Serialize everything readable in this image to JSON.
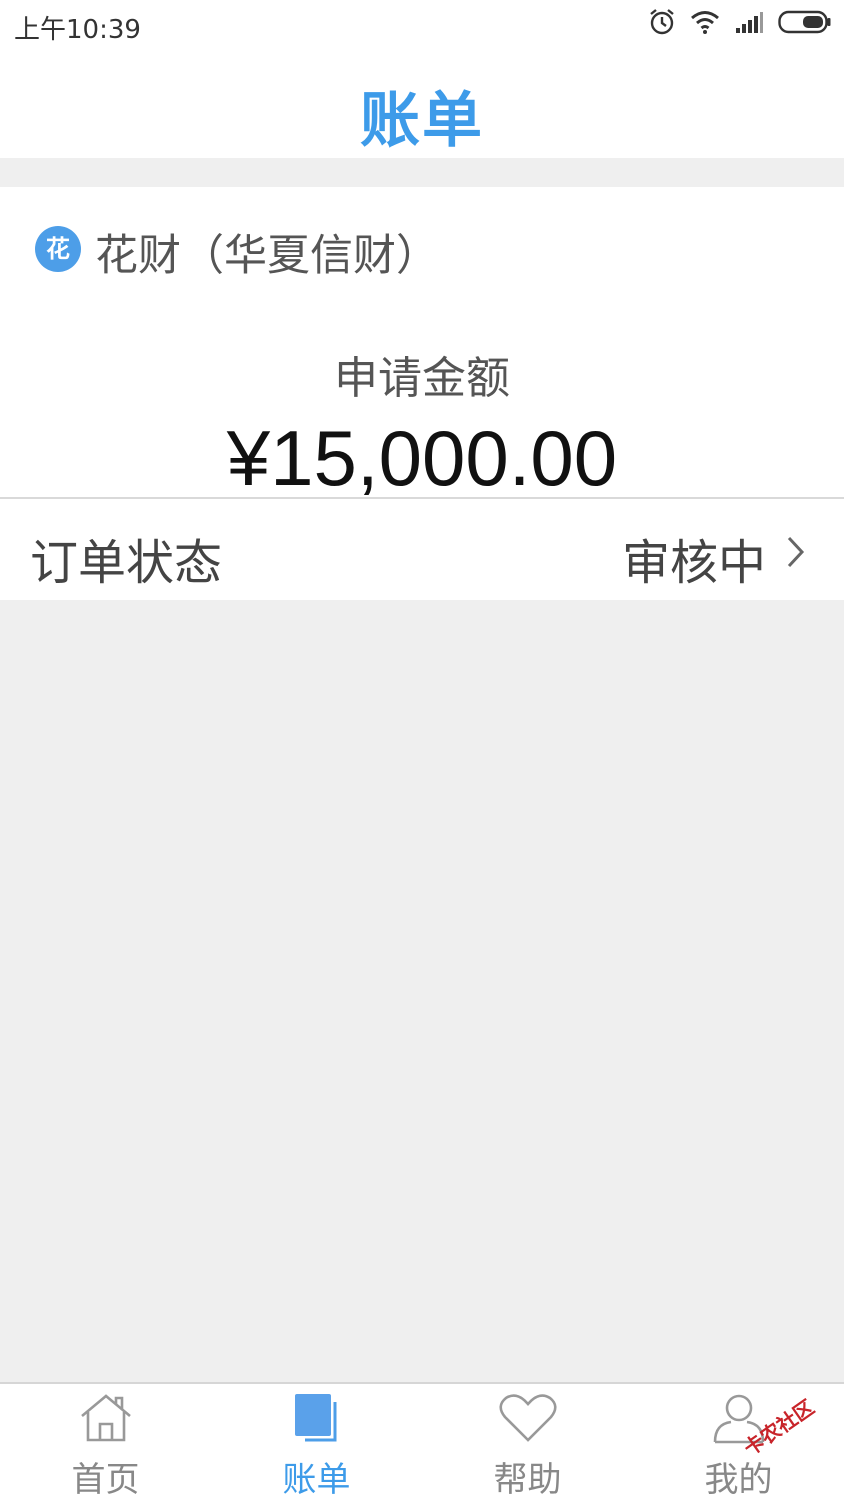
{
  "status_bar": {
    "time": "上午10:39",
    "icons": [
      "alarm-icon",
      "wifi-icon",
      "signal-icon",
      "battery-icon"
    ]
  },
  "header": {
    "title": "账单"
  },
  "order_card": {
    "badge": "花",
    "product_name": "花财（华夏信财）",
    "amount_label": "申请金额",
    "amount_value": "¥15,000.00"
  },
  "order_status": {
    "label": "订单状态",
    "value": "审核中"
  },
  "tabbar": {
    "items": [
      {
        "label": "首页",
        "icon": "home-icon",
        "active": false
      },
      {
        "label": "账单",
        "icon": "bill-icon",
        "active": true
      },
      {
        "label": "帮助",
        "icon": "heart-icon",
        "active": false
      },
      {
        "label": "我的",
        "icon": "person-icon",
        "active": false
      }
    ]
  },
  "watermark": {
    "text": "卡农社区"
  },
  "colors": {
    "accent": "#3d9be9",
    "background": "#efefef",
    "text_primary": "#111111",
    "text_secondary": "#555555",
    "tab_inactive": "#888888"
  }
}
